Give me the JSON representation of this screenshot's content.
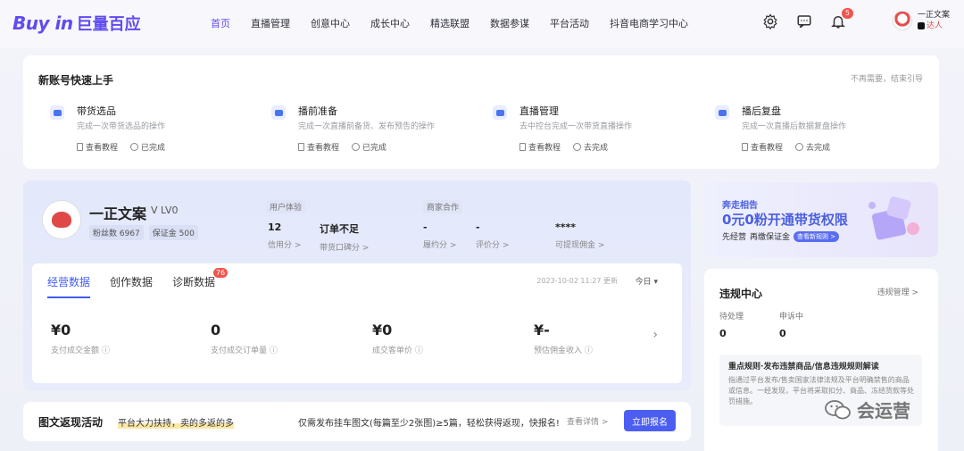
{
  "nav": {
    "logo_en": "Buy in",
    "logo_cn": "巨量百应",
    "items": [
      "首页",
      "直播管理",
      "创意中心",
      "成长中心",
      "精选联盟",
      "数据参谋",
      "平台活动",
      "抖音电商学习中心"
    ],
    "notification_count": "5",
    "user_name": "一正文案",
    "user_tag": "达人"
  },
  "quick_start": {
    "title": "新账号快速上手",
    "dismiss": "不再需要，结束引导",
    "steps": [
      {
        "title": "带货选品",
        "desc": "完成一次带货选品的操作",
        "link1": "查看教程",
        "link2": "已完成"
      },
      {
        "title": "播前准备",
        "desc": "完成一次直播前备货、发布预告的操作",
        "link1": "查看教程",
        "link2": "已完成"
      },
      {
        "title": "直播管理",
        "desc": "去中控台完成一次带货直播操作",
        "link1": "查看教程",
        "link2": "去完成"
      },
      {
        "title": "播后复盘",
        "desc": "完成一次直播后数据复盘操作",
        "link1": "查看教程",
        "link2": "去完成"
      }
    ]
  },
  "profile": {
    "name": "一正文案",
    "level": "LV0",
    "fans": "粉丝数 6967",
    "deposit": "保证金 500",
    "sections": {
      "user_exp": "用户体验",
      "merchant": "商家合作"
    },
    "metrics": [
      {
        "value": "12",
        "label": "信用分 >"
      },
      {
        "value": "订单不足",
        "label": "带货口碑分 >"
      },
      {
        "value": "-",
        "label": "履约分 >"
      },
      {
        "value": "-",
        "label": "评价分 >"
      },
      {
        "value": "****",
        "label": "可提现佣金 >"
      }
    ]
  },
  "data_panel": {
    "tabs": [
      "经营数据",
      "创作数据",
      "诊断数据"
    ],
    "diagnosis_badge": "76",
    "updated": "2023-10-02 11:27 更新",
    "range": "今日 ▾",
    "kpis": [
      {
        "value": "¥0",
        "label": "支付成交金额 ⓘ"
      },
      {
        "value": "0",
        "label": "支付成交订单量 ⓘ"
      },
      {
        "value": "¥0",
        "label": "成交客单价 ⓘ"
      },
      {
        "value": "¥-",
        "label": "预估佣金收入 ⓘ"
      }
    ]
  },
  "banner": {
    "line1": "奔走相告",
    "line2": "0元0粉开通带货权限",
    "line3a": "先经营",
    "line3b": "再缴保证金",
    "cta": "查看新规则 >"
  },
  "violation": {
    "title": "违规中心",
    "manage": "违规管理 >",
    "pending_label": "待处理",
    "pending_value": "0",
    "appeal_label": "申诉中",
    "appeal_value": "0",
    "rule_title": "重点规则·发布违禁商品/信息违规规则解读",
    "rule_text": "指通过平台发布/售卖国家法律法规及平台明确禁售的商品或信息。一经发现，平台将采取扣分、商品、冻结货款等处罚措施。"
  },
  "activity": {
    "title": "图文返现活动",
    "subtitle": "平台大力扶持，卖的多返的多",
    "desc": "仅需发布挂车图文(每篇至少2张图)≥5篇，轻松获得返现，快报名!",
    "link": "查看详情 >",
    "button": "立即报名"
  },
  "watermark": "会运营",
  "colors": {
    "brand": "#5f4bf0",
    "accent_blue": "#3f5af2",
    "badge_red": "#f0544d"
  }
}
